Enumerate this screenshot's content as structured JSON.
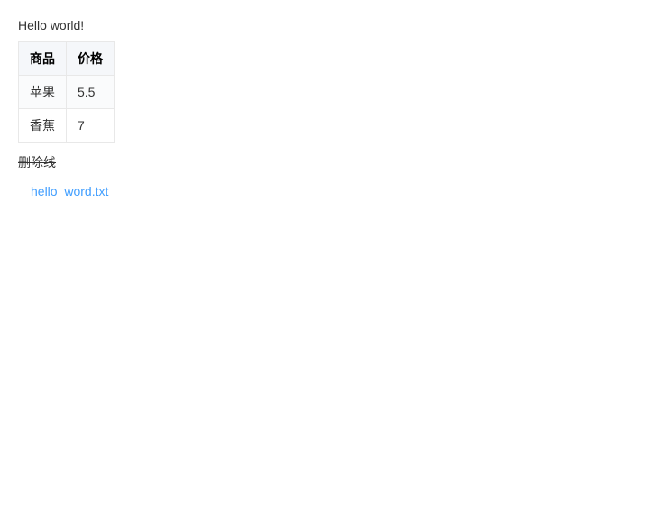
{
  "greeting": "Hello world!",
  "table": {
    "headers": [
      "商品",
      "价格"
    ],
    "rows": [
      {
        "product": "苹果",
        "price": "5.5"
      },
      {
        "product": "香蕉",
        "price": "7"
      }
    ]
  },
  "strikethrough_text": "删除线",
  "attachment_label": "hello_word.txt"
}
